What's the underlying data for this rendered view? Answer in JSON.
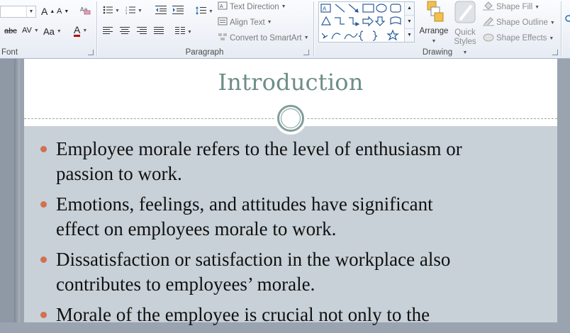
{
  "ribbon": {
    "font_group": {
      "label": "Font",
      "grow_font": "A",
      "shrink_font": "A",
      "strikethrough": "abc",
      "char_spacing": "AV",
      "change_case": "Aa",
      "font_color": "A"
    },
    "paragraph_group": {
      "label": "Paragraph",
      "text_direction": "Text Direction",
      "align_text": "Align Text",
      "convert_smartart": "Convert to SmartArt"
    },
    "drawing_group": {
      "label": "Drawing",
      "arrange": "Arrange",
      "quick_styles_line1": "Quick",
      "quick_styles_line2": "Styles",
      "shape_fill": "Shape Fill",
      "shape_outline": "Shape Outline",
      "shape_effects": "Shape Effects"
    }
  },
  "slide": {
    "title": "Introduction",
    "bullets": [
      {
        "line1": "Employee morale refers to the level of enthusiasm  or",
        "line2": "passion to work."
      },
      {
        "line1": "Emotions, feelings, and attitudes have significant",
        "line2": "effect on employees morale to work."
      },
      {
        "line1": "Dissatisfaction or satisfaction in the workplace also",
        "line2": "contributes to  employees’ morale."
      },
      {
        "line1": "Morale of the employee is crucial not only to the",
        "line2": ""
      }
    ]
  },
  "colors": {
    "title": "#6d8d88",
    "bullet": "#d2704f",
    "content_bg": "#c8d1d8",
    "ring": "#7f9e9a"
  }
}
